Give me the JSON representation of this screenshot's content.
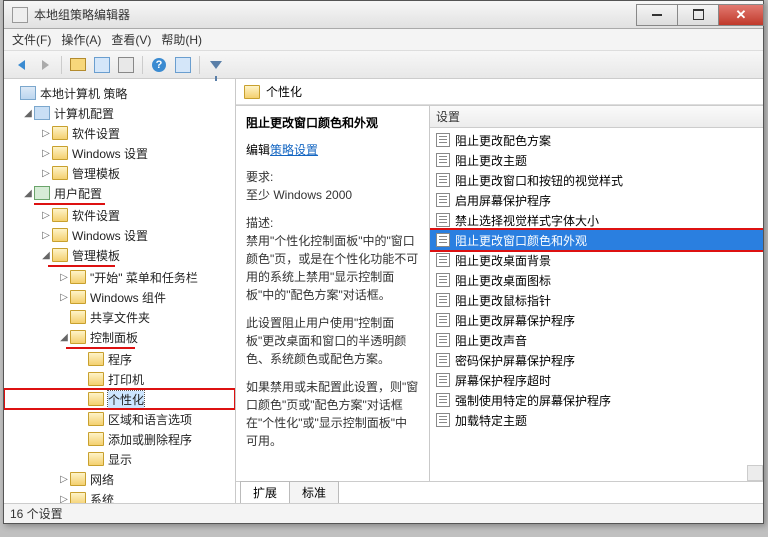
{
  "title": "本地组策略编辑器",
  "menu": {
    "file": "文件(F)",
    "action": "操作(A)",
    "view": "查看(V)",
    "help": "帮助(H)"
  },
  "tree": {
    "root": "本地计算机 策略",
    "comp": "计算机配置",
    "c1": "软件设置",
    "c2": "Windows 设置",
    "c3": "管理模板",
    "user": "用户配置",
    "u1": "软件设置",
    "u2": "Windows 设置",
    "u3": "管理模板",
    "u3a": "\"开始\" 菜单和任务栏",
    "u3b": "Windows 组件",
    "u3c": "共享文件夹",
    "u3d": "控制面板",
    "u3d1": "程序",
    "u3d2": "打印机",
    "u3d3": "个性化",
    "u3d4": "区域和语言选项",
    "u3d5": "添加或删除程序",
    "u3d6": "显示",
    "u3e": "网络",
    "u3f": "系统"
  },
  "right": {
    "heading": "个性化",
    "detail_title": "阻止更改窗口颜色和外观",
    "edit_prefix": "编辑",
    "edit_link": "策略设置",
    "req_label": "要求:",
    "req_value": "至少 Windows 2000",
    "desc_label": "描述:",
    "desc1": "禁用\"个性化控制面板\"中的\"窗口颜色\"页，或是在个性化功能不可用的系统上禁用\"显示控制面板\"中的\"配色方案\"对话框。",
    "desc2": "此设置阻止用户使用\"控制面板\"更改桌面和窗口的半透明颜色、系统颜色或配色方案。",
    "desc3": "如果禁用或未配置此设置，则\"窗口颜色\"页或\"配色方案\"对话框在\"个性化\"或\"显示控制面板\"中可用。",
    "col_header": "设置",
    "items": [
      "阻止更改配色方案",
      "阻止更改主题",
      "阻止更改窗口和按钮的视觉样式",
      "启用屏幕保护程序",
      "禁止选择视觉样式字体大小",
      "阻止更改窗口颜色和外观",
      "阻止更改桌面背景",
      "阻止更改桌面图标",
      "阻止更改鼠标指针",
      "阻止更改屏幕保护程序",
      "阻止更改声音",
      "密码保护屏幕保护程序",
      "屏幕保护程序超时",
      "强制使用特定的屏幕保护程序",
      "加载特定主题"
    ],
    "selected_index": 5,
    "tab_ext": "扩展",
    "tab_std": "标准"
  },
  "status": "16 个设置"
}
